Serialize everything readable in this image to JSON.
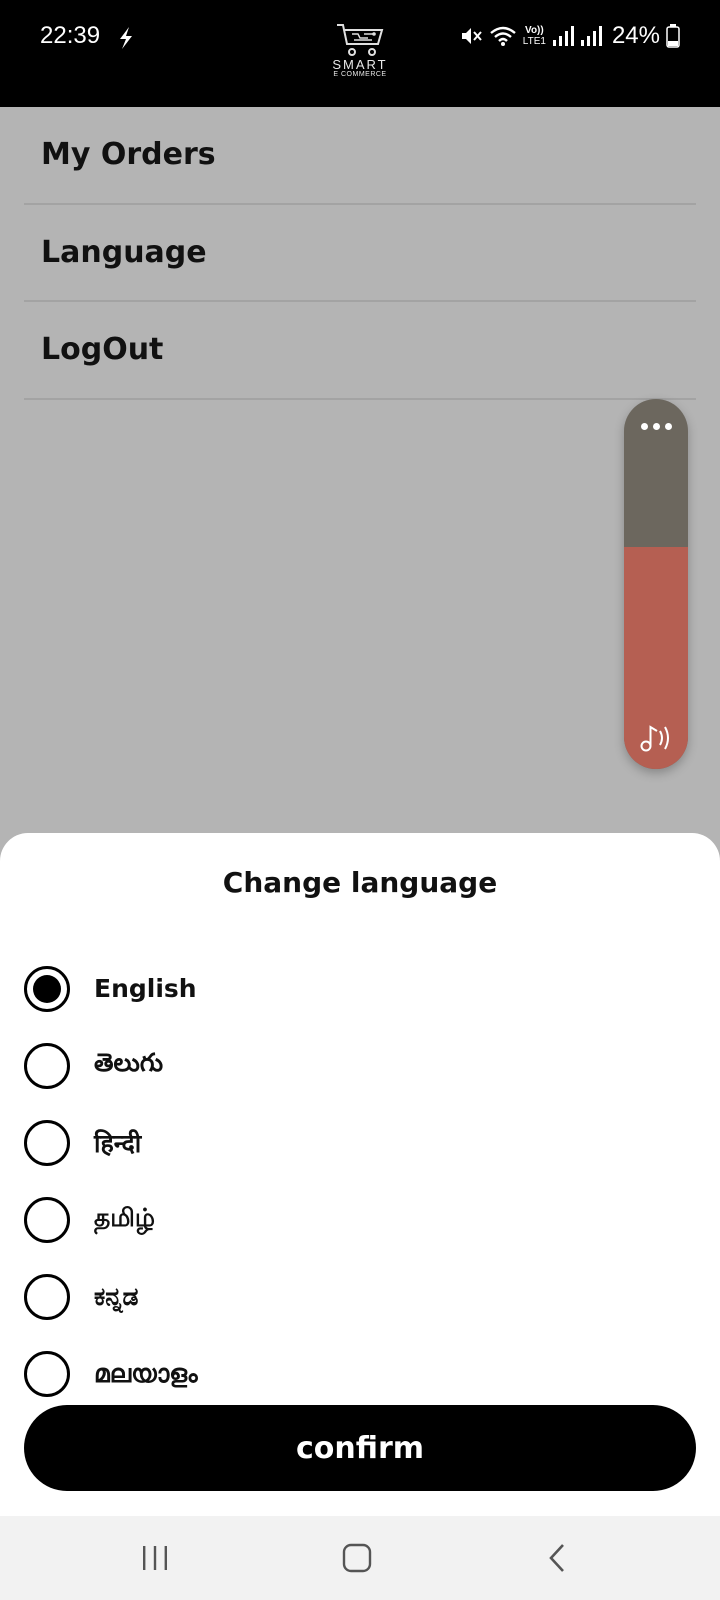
{
  "status_bar": {
    "time": "22:39",
    "battery_pct": "24%",
    "network_label_top": "Vo))",
    "network_label_bottom": "LTE1"
  },
  "logo": {
    "title": "SMART",
    "subtitle": "E COMMERCE"
  },
  "menu": {
    "items": [
      {
        "label": "My Orders"
      },
      {
        "label": "Language"
      },
      {
        "label": "LogOut"
      }
    ]
  },
  "volume": {
    "level": 0.6,
    "more_icon": "more-horizontal-icon",
    "media_icon": "music-note-icon"
  },
  "sheet": {
    "title": "Change language",
    "options": [
      {
        "label": "English",
        "selected": true
      },
      {
        "label": "తెలుగు",
        "selected": false
      },
      {
        "label": "हिन्दी",
        "selected": false
      },
      {
        "label": "தமிழ்",
        "selected": false
      },
      {
        "label": "ಕನ್ನಡ",
        "selected": false
      },
      {
        "label": "മലയാളം",
        "selected": false
      }
    ],
    "confirm_label": "confirm"
  },
  "colors": {
    "status_bar_bg": "#000000",
    "scrim": "#b4b4b4",
    "volume_track": "#6c675e",
    "volume_fill": "#b55f52",
    "button_bg": "#000000"
  }
}
